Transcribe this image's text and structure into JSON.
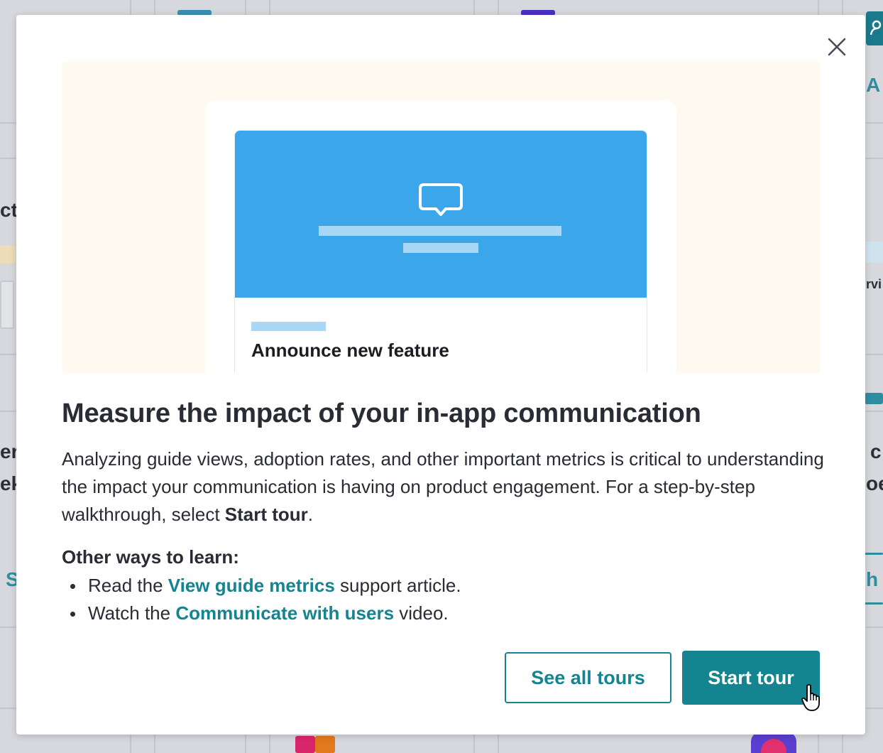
{
  "background": {
    "fragments": [
      "ct",
      "er",
      "ek",
      "S",
      "A",
      "rvi",
      "c",
      "oe",
      "h"
    ]
  },
  "modal": {
    "hero": {
      "card_title": "Announce new feature",
      "icon": "chat-bubble-icon"
    },
    "title": "Measure the impact of your in-app communication",
    "description": {
      "text": "Analyzing guide views, adoption rates, and other important metrics is critical to understanding the impact your communication is having on product engagement. For a step-by-step walkthrough, select ",
      "strong": "Start tour",
      "end": "."
    },
    "learn": {
      "heading": "Other ways to learn:",
      "items": [
        {
          "prefix": "Read the ",
          "link": "View guide metrics",
          "suffix": " support article."
        },
        {
          "prefix": "Watch the ",
          "link": "Communicate with users",
          "suffix": " video."
        }
      ]
    },
    "buttons": {
      "secondary": "See all tours",
      "primary": "Start tour"
    },
    "close_icon": "close-icon"
  },
  "colors": {
    "accent": "#148491",
    "hero_bg": "#fffaf0",
    "hero_blue": "#3ca6ea",
    "text": "#2a2c35"
  }
}
